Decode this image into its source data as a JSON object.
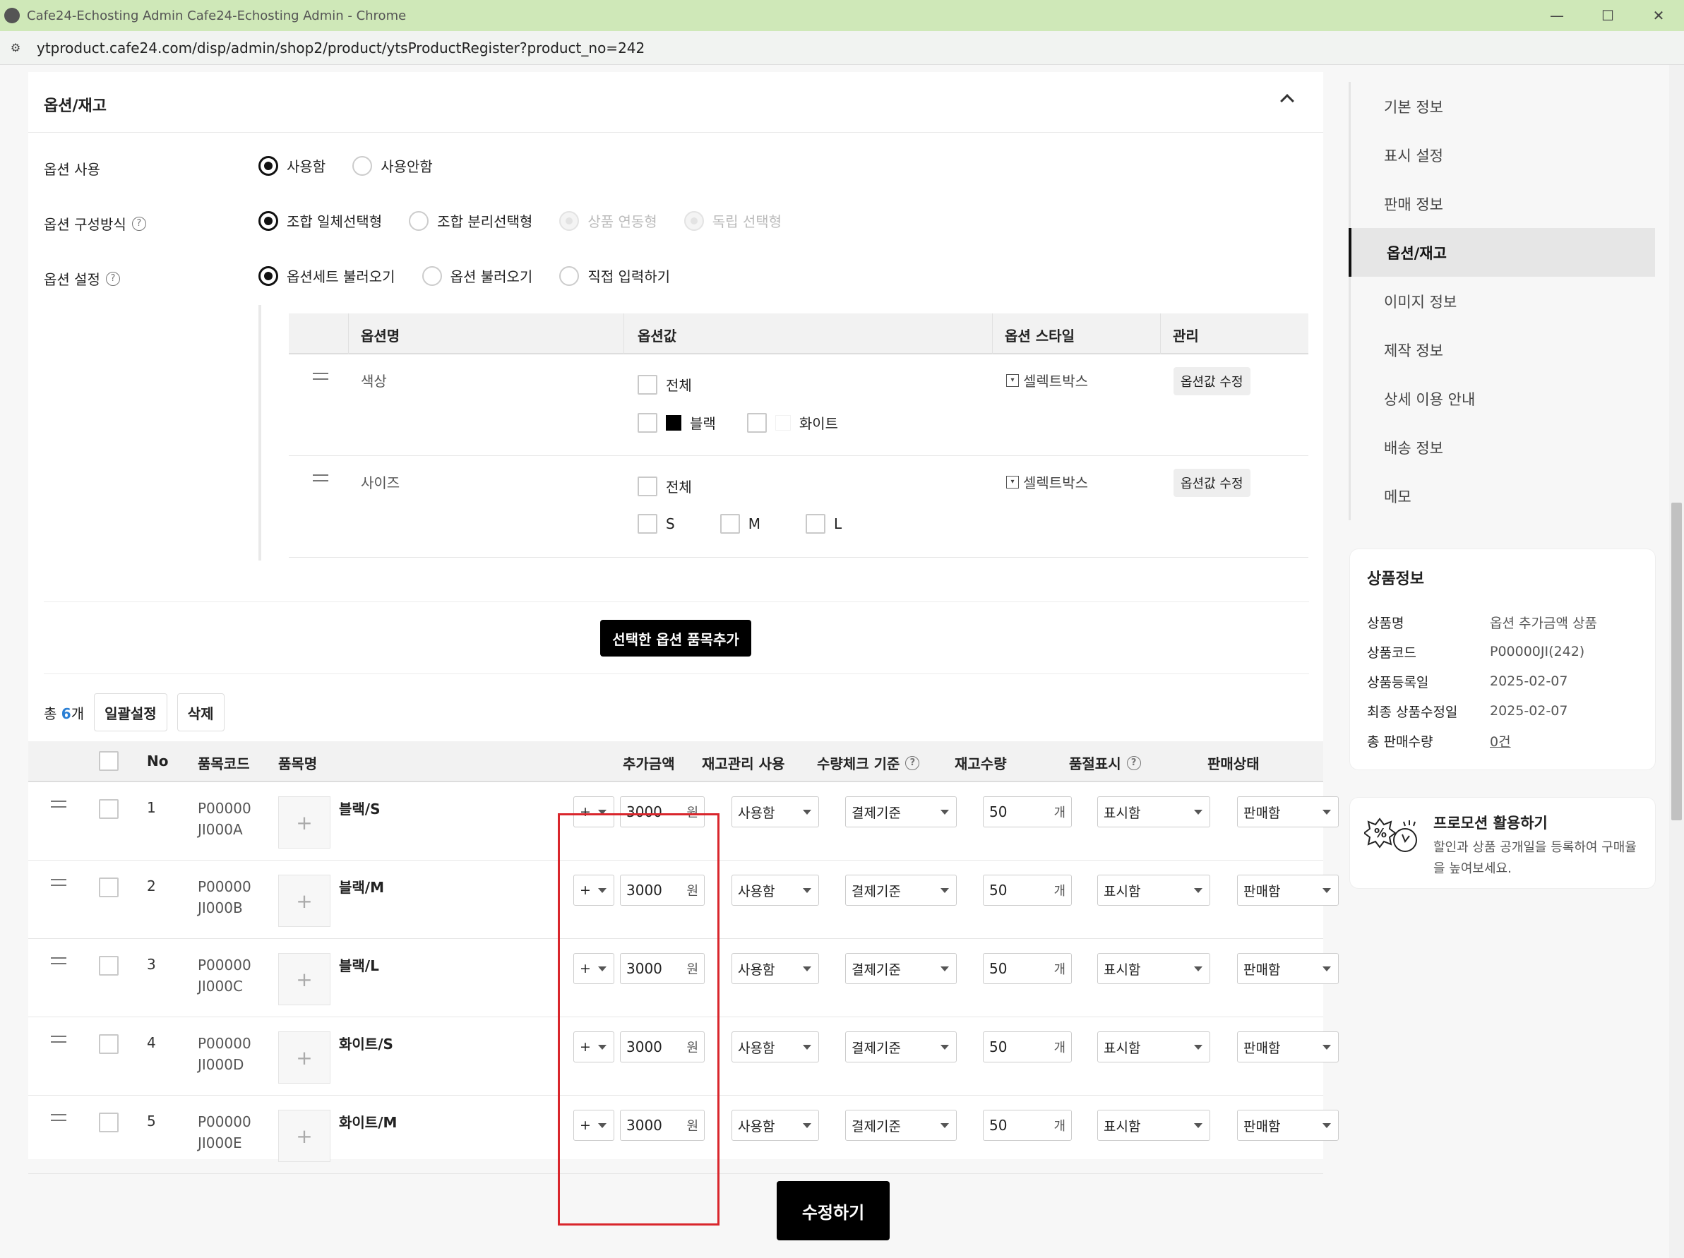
{
  "browser": {
    "title": "Cafe24-Echosting Admin Cafe24-Echosting Admin - Chrome",
    "url": "ytproduct.cafe24.com/disp/admin/shop2/product/ytsProductRegister?product_no=242"
  },
  "section": {
    "title": "옵션/재고",
    "option_use": {
      "label": "옵션 사용",
      "choices": [
        "사용함",
        "사용안함"
      ],
      "selected": "사용함"
    },
    "option_type": {
      "label": "옵션 구성방식",
      "choices": [
        "조합 일체선택형",
        "조합 분리선택형",
        "상품 연동형",
        "독립 선택형"
      ],
      "selected": "조합 일체선택형"
    },
    "option_setting": {
      "label": "옵션 설정",
      "choices": [
        "옵션세트 불러오기",
        "옵션 불러오기",
        "직접 입력하기"
      ],
      "selected": "옵션세트 불러오기"
    }
  },
  "option_table": {
    "headers": [
      "옵션명",
      "옵션값",
      "옵션 스타일",
      "관리"
    ],
    "rows": [
      {
        "name": "색상",
        "all_label": "전체",
        "values": [
          {
            "label": "블랙",
            "swatch": "#000000"
          },
          {
            "label": "화이트",
            "swatch": "#ffffff"
          }
        ],
        "style": "셀렉트박스",
        "edit": "옵션값 수정"
      },
      {
        "name": "사이즈",
        "all_label": "전체",
        "values": [
          {
            "label": "S"
          },
          {
            "label": "M"
          },
          {
            "label": "L"
          }
        ],
        "style": "셀렉트박스",
        "edit": "옵션값 수정"
      }
    ]
  },
  "add_button": "선택한 옵션 품목추가",
  "summary": {
    "prefix": "총",
    "count": "6",
    "suffix": "개",
    "bulk_button": "일괄설정",
    "delete_button": "삭제"
  },
  "grid": {
    "headers": {
      "no": "No",
      "code": "품목코드",
      "name": "품목명",
      "extra": "추가금액",
      "stock_use": "재고관리 사용",
      "qty_check": "수량체크 기준",
      "stock_qty": "재고수량",
      "soldout": "품절표시",
      "sale": "판매상태"
    },
    "rows": [
      {
        "no": "1",
        "code1": "P00000",
        "code2": "JI000A",
        "name": "블랙/S",
        "sign": "+",
        "amount": "3000",
        "won": "원",
        "stock_use": "사용함",
        "qty_check": "결제기준",
        "qty": "50",
        "ea": "개",
        "soldout": "표시함",
        "sale": "판매함"
      },
      {
        "no": "2",
        "code1": "P00000",
        "code2": "JI000B",
        "name": "블랙/M",
        "sign": "+",
        "amount": "3000",
        "won": "원",
        "stock_use": "사용함",
        "qty_check": "결제기준",
        "qty": "50",
        "ea": "개",
        "soldout": "표시함",
        "sale": "판매함"
      },
      {
        "no": "3",
        "code1": "P00000",
        "code2": "JI000C",
        "name": "블랙/L",
        "sign": "+",
        "amount": "3000",
        "won": "원",
        "stock_use": "사용함",
        "qty_check": "결제기준",
        "qty": "50",
        "ea": "개",
        "soldout": "표시함",
        "sale": "판매함"
      },
      {
        "no": "4",
        "code1": "P00000",
        "code2": "JI000D",
        "name": "화이트/S",
        "sign": "+",
        "amount": "3000",
        "won": "원",
        "stock_use": "사용함",
        "qty_check": "결제기준",
        "qty": "50",
        "ea": "개",
        "soldout": "표시함",
        "sale": "판매함"
      },
      {
        "no": "5",
        "code1": "P00000",
        "code2": "JI000E",
        "name": "화이트/M",
        "sign": "+",
        "amount": "3000",
        "won": "원",
        "stock_use": "사용함",
        "qty_check": "결제기준",
        "qty": "50",
        "ea": "개",
        "soldout": "표시함",
        "sale": "판매함"
      }
    ]
  },
  "save_button": "수정하기",
  "sidenav": {
    "items": [
      "기본 정보",
      "표시 설정",
      "판매 정보",
      "옵션/재고",
      "이미지 정보",
      "제작 정보",
      "상세 이용 안내",
      "배송 정보",
      "메모"
    ],
    "active": "옵션/재고"
  },
  "product_info": {
    "title": "상품정보",
    "rows": [
      {
        "k": "상품명",
        "v": "옵션 추가금액 상품"
      },
      {
        "k": "상품코드",
        "v": "P00000JI(242)"
      },
      {
        "k": "상품등록일",
        "v": "2025-02-07"
      },
      {
        "k": "최종 상품수정일",
        "v": "2025-02-07"
      },
      {
        "k": "총 판매수량",
        "v": "0건"
      }
    ]
  },
  "promo": {
    "title": "프로모션 활용하기",
    "text": "할인과 상품 공개일을 등록하여 구매율을 높여보세요."
  },
  "colors": {
    "highlight": "#d9262c",
    "accent": "#2a7fd4",
    "titlebar": "#cfe8b8"
  }
}
